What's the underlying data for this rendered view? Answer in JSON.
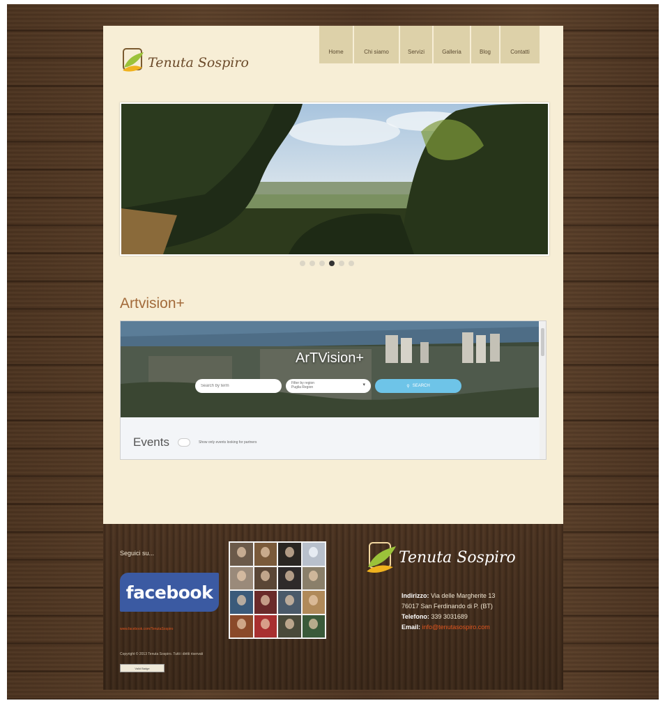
{
  "site": {
    "brand": "Tenuta Sospiro",
    "nav": [
      "Home",
      "Chi siamo",
      "Servizi",
      "Galleria",
      "Blog",
      "Contatti"
    ],
    "slider": {
      "dots": 6,
      "active_index": 3
    }
  },
  "section": {
    "title": "Artvision+"
  },
  "embed": {
    "hero_title": "ArTVision+",
    "search_placeholder": "Search by term",
    "region_label": "Filter by region",
    "region_value": "Puglia Region",
    "search_button": "SEARCH",
    "events_title": "Events",
    "events_toggle_label": "Show only events looking for partners"
  },
  "footer": {
    "follow_label": "Seguici su...",
    "facebook_label": "facebook",
    "facebook_link": "www.facebook.com/TenutaSospiro",
    "copyright": "Copyright © 2013 Tenuta Sospiro. Tutti i diritti riservati",
    "badge": "Valid Badge",
    "brand": "Tenuta Sospiro",
    "address_label": "Indirizzo:",
    "address_line1": "Via delle Margherite 13",
    "address_line2": "76017 San Ferdinando di P. (BT)",
    "phone_label": "Telefono:",
    "phone": "339 3031689",
    "email_label": "Email:",
    "email": "info@tenutasospiro.com"
  },
  "colors": {
    "page_bg": "#f7eed6",
    "nav_bg": "#ddd1a9",
    "title": "#a26a3a",
    "link_orange": "#e0561f",
    "facebook_blue": "#3b5aa2",
    "search_blue": "#6ec4e8"
  }
}
